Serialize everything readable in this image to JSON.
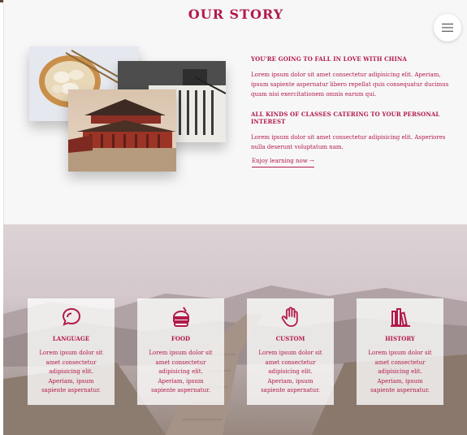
{
  "header": {
    "title": "OUR STORY",
    "menu_icon": "hamburger-menu-icon"
  },
  "story": {
    "heading_1": "YOU'RE GOING TO FALL IN LOVE WITH CHINA",
    "paragraph_1": "Lorem ipsum dolor sit amet consectetur adipisicing elit. Aperiam, ipsum sapiente aspernatur libero repellat quis consequatur ducimus quam nisi exercitationem omnis earum qui.",
    "heading_2": "ALL KINDS OF CLASSES CATERING TO YOUR PERSONAL INTEREST",
    "paragraph_2": "Lorem ipsum dolor sit amet consectetur adipisicing elit. Asperiores nulla deserunt voluptatum nam.",
    "cta_label": "Enjoy learning now →"
  },
  "features": [
    {
      "title": "LANGUAGE",
      "text": "Lorem ipsum dolor sit amet consectetur adipisicing elit. Aperiam, ipsum sapiente aspernatur.",
      "icon": "speech-bubbles-icon"
    },
    {
      "title": "FOOD",
      "text": "Lorem ipsum dolor sit amet consectetur adipisicing elit. Aperiam, ipsum sapiente aspernatur.",
      "icon": "fast-food-icon"
    },
    {
      "title": "CUSTOM",
      "text": "Lorem ipsum dolor sit amet consectetur adipisicing elit. Aperiam, ipsum sapiente aspernatur.",
      "icon": "hand-icon"
    },
    {
      "title": "HISTORY",
      "text": "Lorem ipsum dolor sit amet consectetur adipisicing elit. Aperiam, ipsum sapiente aspernatur.",
      "icon": "books-icon"
    }
  ],
  "colors": {
    "accent": "#b21a4b",
    "section_bg": "#f7f7f7"
  }
}
